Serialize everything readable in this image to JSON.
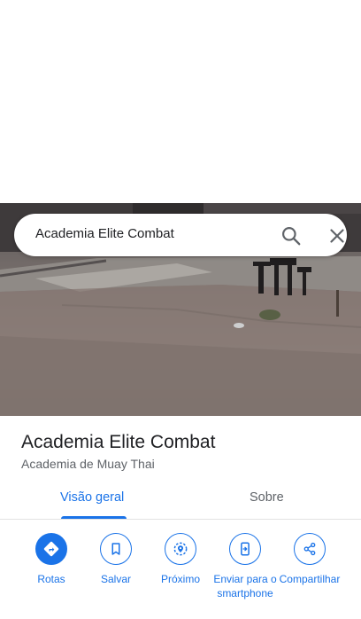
{
  "search": {
    "query": "Academia Elite Combat",
    "search_icon": "search-icon",
    "close_icon": "close-icon"
  },
  "place": {
    "title": "Academia Elite Combat",
    "category": "Academia de Muay Thai"
  },
  "tabs": [
    {
      "label": "Visão geral",
      "active": true
    },
    {
      "label": "Sobre",
      "active": false
    }
  ],
  "actions": [
    {
      "label": "Rotas",
      "icon": "directions-icon"
    },
    {
      "label": "Salvar",
      "icon": "bookmark-icon"
    },
    {
      "label": "Próximo",
      "icon": "nearby-icon"
    },
    {
      "label": "Enviar para o smartphone",
      "icon": "send-to-phone-icon"
    },
    {
      "label": "Compartilhar",
      "icon": "share-icon"
    }
  ],
  "colors": {
    "accent": "#1a73e8",
    "text_primary": "#202124",
    "text_secondary": "#5f6368"
  }
}
